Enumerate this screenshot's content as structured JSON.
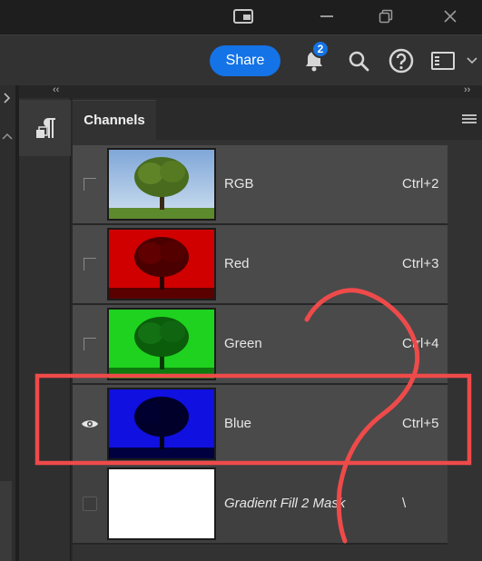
{
  "window": {
    "controls": [
      {
        "icon": "window-icon"
      },
      {
        "icon": "minimize-icon"
      },
      {
        "icon": "restore-icon"
      },
      {
        "icon": "close-icon"
      }
    ]
  },
  "appbar": {
    "share_label": "Share",
    "notification_count": "2",
    "icons": [
      "bell-icon",
      "search-icon",
      "help-icon",
      "workspace-icon",
      "chevron-down-icon"
    ]
  },
  "dock": {
    "collapse_left": "‹‹",
    "collapse_right": "››",
    "para_icon": "paragraph-icon"
  },
  "panel": {
    "tab_label": "Channels",
    "menu_icon": "panel-menu-icon"
  },
  "channels": [
    {
      "name": "RGB",
      "shortcut": "Ctrl+2",
      "visible": false,
      "thumb": "rgb"
    },
    {
      "name": "Red",
      "shortcut": "Ctrl+3",
      "visible": false,
      "thumb": "red"
    },
    {
      "name": "Green",
      "shortcut": "Ctrl+4",
      "visible": false,
      "thumb": "green"
    },
    {
      "name": "Blue",
      "shortcut": "Ctrl+5",
      "visible": true,
      "thumb": "blue"
    },
    {
      "name": "Gradient Fill 2 Mask",
      "shortcut": "\\",
      "visible": false,
      "thumb": "mask"
    }
  ],
  "colors": {
    "accent": "#1473e6",
    "annotation": "#ef4a4a"
  }
}
